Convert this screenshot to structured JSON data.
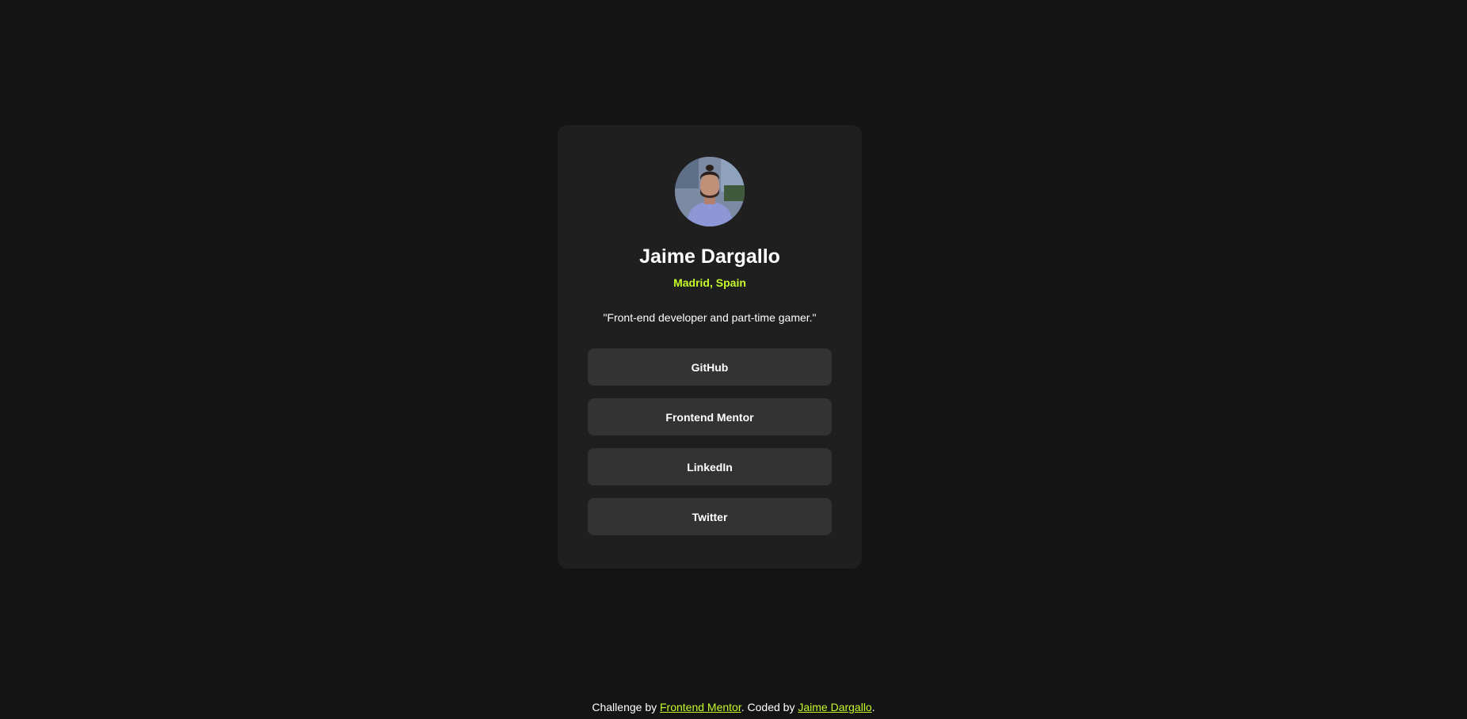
{
  "profile": {
    "name": "Jaime Dargallo",
    "location": "Madrid, Spain",
    "bio": "\"Front-end developer and part-time gamer.\"",
    "avatar_alt": "avatar-photo"
  },
  "links": [
    {
      "label": "GitHub"
    },
    {
      "label": "Frontend Mentor"
    },
    {
      "label": "LinkedIn"
    },
    {
      "label": "Twitter"
    }
  ],
  "footer": {
    "prefix": "Challenge by ",
    "challenge_link": "Frontend Mentor",
    "middle": ". Coded by ",
    "author_link": "Jaime Dargallo",
    "suffix": "."
  },
  "colors": {
    "background": "#141414",
    "card": "#1f1f1f",
    "button": "#333333",
    "accent": "#c4f82a",
    "text": "#ffffff"
  }
}
